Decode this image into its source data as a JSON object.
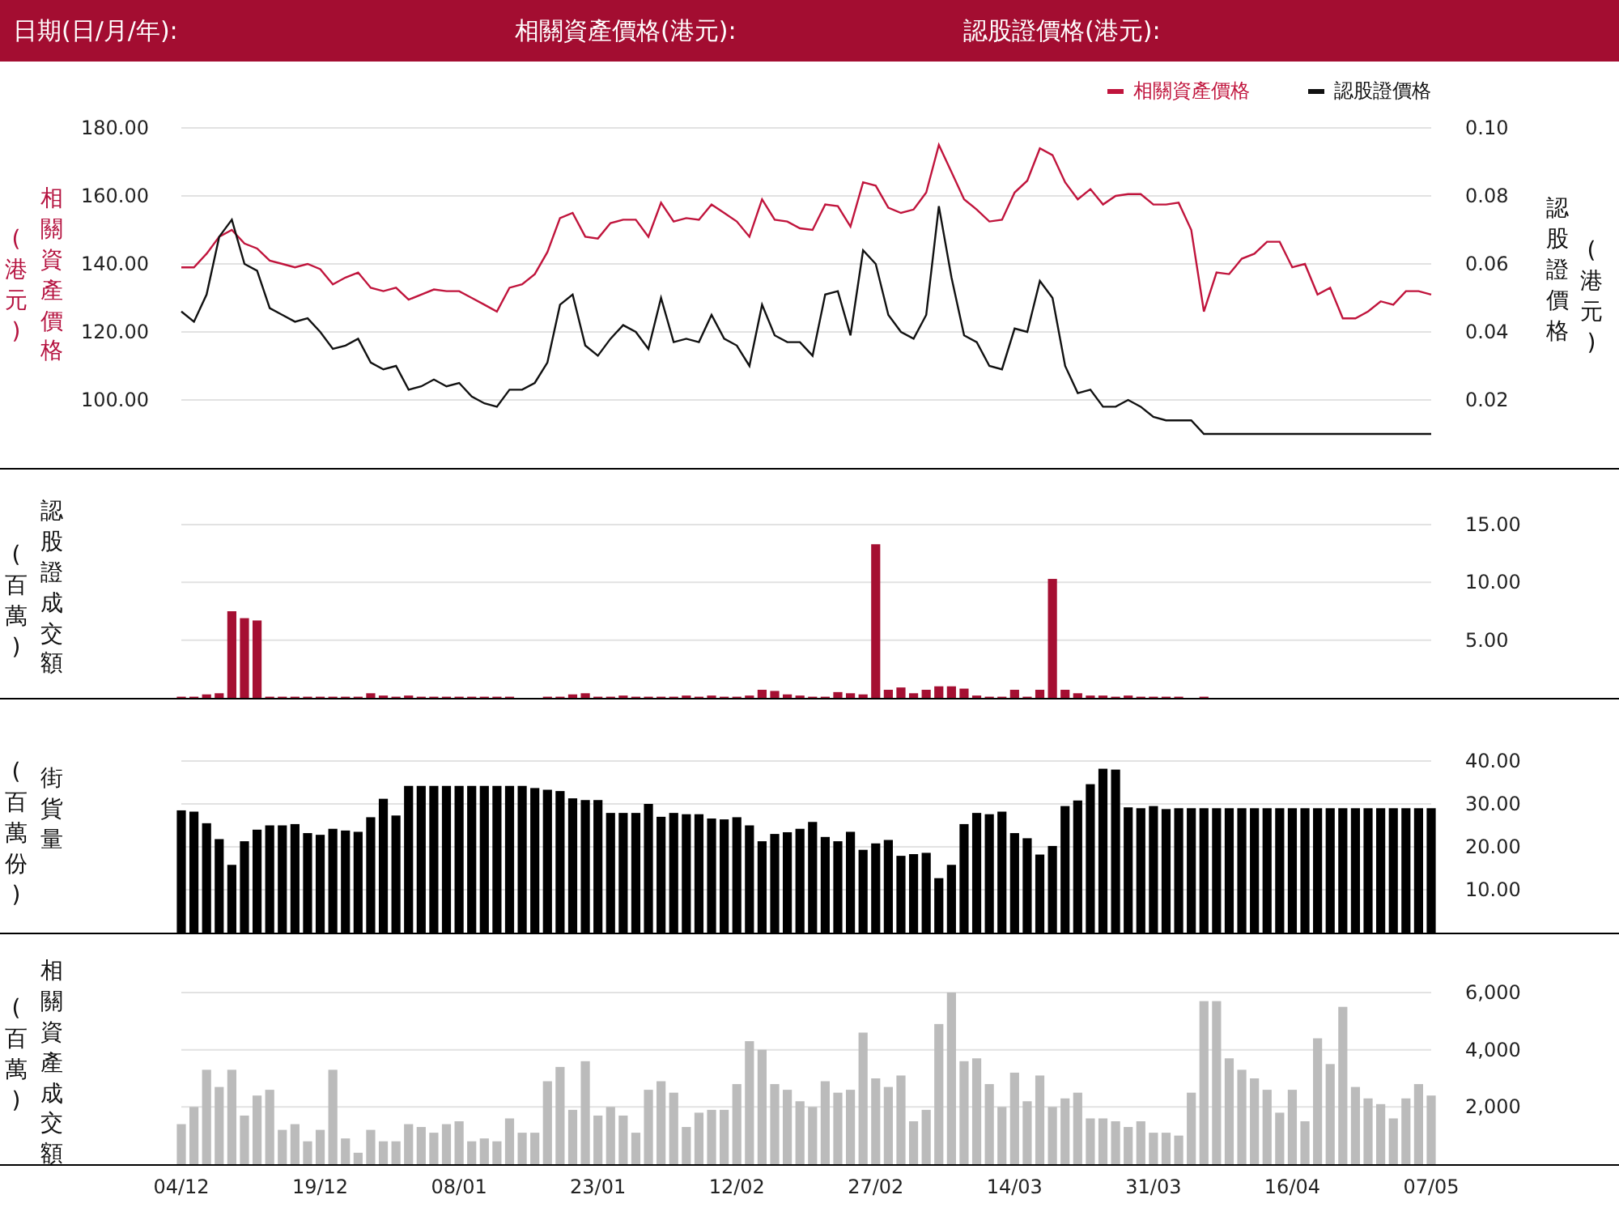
{
  "header": {
    "fields": [
      "日期(日/月/年):",
      "相關資產價格(港元):",
      "認股證價格(港元):"
    ]
  },
  "price_panel": {
    "left_title": "相關資產價格",
    "left_unit": "(港元)",
    "right_title": "認股證價格",
    "right_unit": "(港元)",
    "chart_data": {
      "type": "line",
      "grid": true,
      "legend": "top-right",
      "ylim": [
        80,
        180
      ],
      "yticks": [
        {
          "value": 100,
          "label": "100.00"
        },
        {
          "value": 120,
          "label": "120.00"
        },
        {
          "value": 140,
          "label": "140.00"
        },
        {
          "value": 160,
          "label": "160.00"
        },
        {
          "value": 180,
          "label": "180.00"
        }
      ],
      "y2lim": [
        0,
        0.1
      ],
      "y2ticks": [
        {
          "value": 0.02,
          "label": "0.02"
        },
        {
          "value": 0.04,
          "label": "0.04"
        },
        {
          "value": 0.06,
          "label": "0.06"
        },
        {
          "value": 0.08,
          "label": "0.08"
        },
        {
          "value": 0.1,
          "label": "0.10"
        }
      ],
      "series": [
        {
          "name": "相關資產價格",
          "color": "#c0143c",
          "values": [
            139,
            139,
            143,
            148,
            150,
            146,
            144.5,
            141,
            140,
            139,
            140,
            138.5,
            134,
            136,
            137.5,
            133,
            132,
            133,
            129.5,
            131,
            132.5,
            132,
            132,
            130,
            128,
            126,
            133,
            134,
            137,
            143.5,
            153.5,
            155,
            148,
            147.5,
            152,
            153,
            153,
            148,
            158,
            152.5,
            153.5,
            153,
            157.5,
            155,
            152.5,
            148,
            159,
            153,
            152.5,
            150.5,
            150,
            157.5,
            157,
            151,
            164,
            163,
            156.5,
            155,
            156,
            161,
            175,
            167,
            159,
            156,
            152.5,
            153,
            161,
            164.5,
            174,
            172,
            164,
            159,
            162,
            157.5,
            160,
            160.5,
            160.5,
            157.5,
            157.5,
            158,
            150,
            126,
            137.5,
            137,
            141.5,
            143,
            146.5,
            146.5,
            139,
            140,
            131,
            133,
            124,
            124,
            126,
            129,
            128,
            132,
            132,
            131
          ]
        },
        {
          "name": "認股證價格",
          "color": "#111111",
          "axis": "y2",
          "values": [
            0.046,
            0.043,
            0.051,
            0.068,
            0.073,
            0.06,
            0.058,
            0.047,
            0.045,
            0.043,
            0.044,
            0.04,
            0.035,
            0.036,
            0.038,
            0.031,
            0.029,
            0.03,
            0.023,
            0.024,
            0.026,
            0.024,
            0.025,
            0.021,
            0.019,
            0.018,
            0.023,
            0.023,
            0.025,
            0.031,
            0.048,
            0.051,
            0.036,
            0.033,
            0.038,
            0.042,
            0.04,
            0.035,
            0.05,
            0.037,
            0.038,
            0.037,
            0.045,
            0.038,
            0.036,
            0.03,
            0.048,
            0.039,
            0.037,
            0.037,
            0.033,
            0.051,
            0.052,
            0.039,
            0.064,
            0.06,
            0.045,
            0.04,
            0.038,
            0.045,
            0.077,
            0.056,
            0.039,
            0.037,
            0.03,
            0.029,
            0.041,
            0.04,
            0.055,
            0.05,
            0.03,
            0.022,
            0.023,
            0.018,
            0.018,
            0.02,
            0.018,
            0.015,
            0.014,
            0.014,
            0.014,
            0.01,
            0.01,
            0.01,
            0.01,
            0.01,
            0.01,
            0.01,
            0.01,
            0.01,
            0.01,
            0.01,
            0.01,
            0.01,
            0.01,
            0.01,
            0.01,
            0.01,
            0.01,
            0.01
          ]
        }
      ]
    }
  },
  "warrant_turnover_panel": {
    "unit": "(百萬)",
    "chart_data": {
      "type": "bar",
      "grid": true,
      "ylim": [
        0,
        15
      ],
      "yticks": [
        {
          "value": 5,
          "label": "5.00"
        },
        {
          "value": 10,
          "label": "10.00"
        },
        {
          "value": 15,
          "label": "15.00"
        }
      ],
      "series": [
        {
          "name": "認股證成交額",
          "color": "#a50f32",
          "values": [
            0.1,
            0.1,
            0.3,
            0.4,
            7.5,
            6.9,
            6.7,
            0.1,
            0.1,
            0.1,
            0.1,
            0.1,
            0.1,
            0.1,
            0.1,
            0.4,
            0.2,
            0.1,
            0.2,
            0.1,
            0.1,
            0.1,
            0.1,
            0.1,
            0.1,
            0.1,
            0.1,
            0,
            0,
            0.1,
            0.1,
            0.3,
            0.4,
            0.1,
            0.1,
            0.2,
            0.1,
            0.1,
            0.1,
            0.1,
            0.2,
            0.1,
            0.2,
            0.1,
            0.1,
            0.2,
            0.7,
            0.6,
            0.3,
            0.2,
            0.1,
            0.1,
            0.5,
            0.4,
            0.3,
            13.3,
            0.7,
            0.9,
            0.4,
            0.7,
            1.0,
            1.0,
            0.8,
            0.2,
            0.1,
            0.1,
            0.7,
            0.1,
            0.7,
            10.3,
            0.7,
            0.4,
            0.2,
            0.2,
            0.1,
            0.2,
            0.1,
            0.1,
            0.1,
            0.1,
            0,
            0.1,
            0,
            0,
            0,
            0,
            0,
            0,
            0,
            0,
            0,
            0,
            0,
            0,
            0,
            0,
            0,
            0,
            0,
            0
          ]
        }
      ]
    }
  },
  "outstanding_panel": {
    "unit": "(百萬份)",
    "chart_data": {
      "type": "bar",
      "grid": true,
      "ylim": [
        0,
        40
      ],
      "yticks": [
        {
          "value": 10,
          "label": "10.00"
        },
        {
          "value": 20,
          "label": "20.00"
        },
        {
          "value": 30,
          "label": "30.00"
        },
        {
          "value": 40,
          "label": "40.00"
        }
      ],
      "series": [
        {
          "name": "街貨量",
          "color": "#000000",
          "values": [
            28.5,
            28.2,
            25.5,
            21.8,
            15.8,
            21.3,
            24.0,
            25.0,
            25.0,
            25.3,
            23.2,
            22.8,
            24.2,
            23.8,
            23.5,
            26.9,
            31.2,
            27.3,
            34.2,
            34.2,
            34.2,
            34.2,
            34.2,
            34.2,
            34.2,
            34.2,
            34.2,
            34.2,
            33.7,
            33.3,
            33.0,
            31.3,
            30.9,
            30.9,
            27.9,
            27.9,
            27.9,
            30.0,
            27.0,
            27.9,
            27.6,
            27.6,
            26.6,
            26.4,
            26.9,
            25.0,
            21.3,
            23.0,
            23.4,
            24.2,
            25.8,
            22.3,
            21.3,
            23.5,
            19.3,
            20.8,
            21.6,
            17.9,
            18.3,
            18.6,
            12.7,
            15.8,
            25.3,
            27.9,
            27.6,
            28.2,
            23.2,
            22.0,
            18.2,
            20.2,
            29.5,
            30.8,
            34.6,
            38.2,
            38.0,
            29.2,
            29.0,
            29.5,
            28.8,
            29.0,
            29.0,
            29.0,
            29.0,
            29.0,
            29.0,
            29.0,
            29.0,
            29.0,
            29.0,
            29.0,
            29.0,
            29.0,
            29.0,
            29.0,
            29.0,
            29.0,
            29.0,
            29.0,
            29.0,
            29.0
          ]
        }
      ]
    }
  },
  "underlying_turnover_panel": {
    "unit": "(百萬)",
    "chart_data": {
      "type": "bar",
      "grid": true,
      "ylim": [
        0,
        6000
      ],
      "yticks": [
        {
          "value": 2000,
          "label": "2,000"
        },
        {
          "value": 4000,
          "label": "4,000"
        },
        {
          "value": 6000,
          "label": "6,000"
        }
      ],
      "categories": [
        "04/12",
        null,
        null,
        null,
        null,
        null,
        null,
        null,
        null,
        null,
        null,
        "19/12",
        null,
        null,
        null,
        null,
        null,
        null,
        null,
        null,
        null,
        null,
        "08/01",
        null,
        null,
        null,
        null,
        null,
        null,
        null,
        null,
        null,
        null,
        "23/01",
        null,
        null,
        null,
        null,
        null,
        null,
        null,
        null,
        null,
        null,
        "12/02",
        null,
        null,
        null,
        null,
        null,
        null,
        null,
        null,
        null,
        null,
        "27/02",
        null,
        null,
        null,
        null,
        null,
        null,
        null,
        null,
        null,
        null,
        "14/03",
        null,
        null,
        null,
        null,
        null,
        null,
        null,
        null,
        null,
        null,
        "31/03",
        null,
        null,
        null,
        null,
        null,
        null,
        null,
        null,
        null,
        null,
        "16/04",
        null,
        null,
        null,
        null,
        null,
        null,
        null,
        null,
        null,
        null,
        "07/05"
      ],
      "series": [
        {
          "name": "相關資產成交額",
          "color": "#bbbbbb",
          "values": [
            1400,
            2000,
            3300,
            2700,
            3300,
            1700,
            2400,
            2600,
            1200,
            1400,
            800,
            1200,
            3300,
            900,
            400,
            1200,
            800,
            800,
            1400,
            1300,
            1100,
            1400,
            1500,
            800,
            900,
            800,
            1600,
            1100,
            1100,
            2900,
            3400,
            1900,
            3600,
            1700,
            2000,
            1700,
            1100,
            2600,
            2900,
            2500,
            1300,
            1800,
            1900,
            1900,
            2800,
            4300,
            4000,
            2800,
            2600,
            2200,
            2000,
            2900,
            2500,
            2600,
            4600,
            3000,
            2700,
            3100,
            1500,
            1900,
            4900,
            6000,
            3600,
            3700,
            2800,
            2000,
            3200,
            2200,
            3100,
            2000,
            2300,
            2500,
            1600,
            1600,
            1500,
            1300,
            1500,
            1100,
            1100,
            1000,
            2500,
            5700,
            5700,
            3700,
            3300,
            3000,
            2600,
            1800,
            2600,
            1500,
            4400,
            3500,
            5500,
            2700,
            2300,
            2100,
            1600,
            2300,
            2800,
            2400
          ]
        }
      ]
    }
  }
}
